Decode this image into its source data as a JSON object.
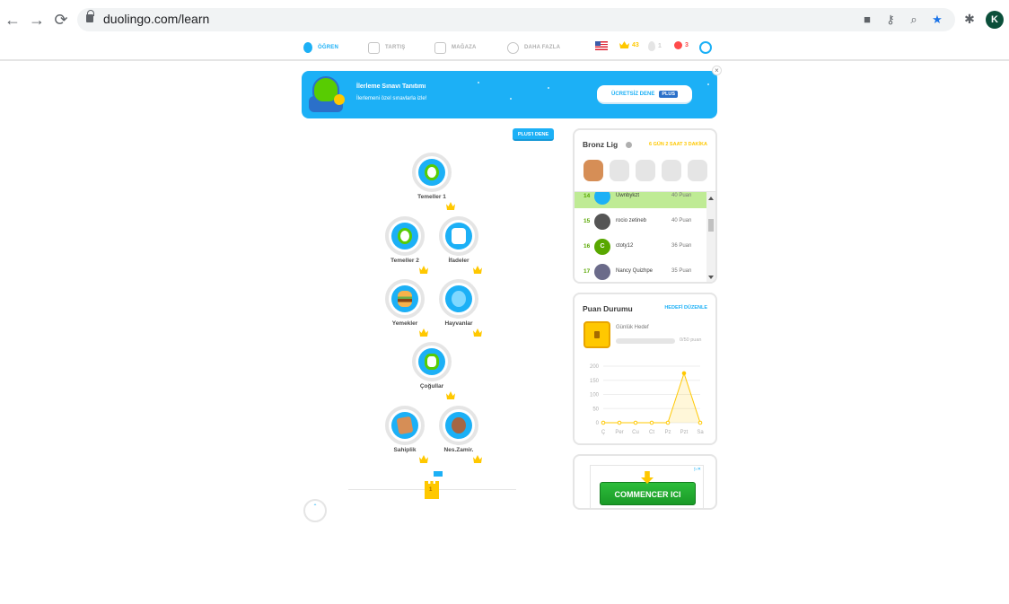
{
  "browser": {
    "url": "duolingo.com/learn",
    "profile_initial": "K"
  },
  "nav": {
    "items": [
      "ÖĞREN",
      "TARTIŞ",
      "MAĞAZA",
      "DAHA FAZLA"
    ],
    "crowns": "43",
    "streak": "1",
    "hearts": "3"
  },
  "banner": {
    "title": "İlerleme Sınavı Tanıtımı",
    "subtitle": "İlerlemeni özel sınavlarla izle!",
    "button_label": "ÜCRETSİZ DENE",
    "plus_tag": "PLUS"
  },
  "tree": {
    "try_plus": "PLUS'I DENE",
    "skills": [
      {
        "label": "Temeller 1",
        "color": "#58cc02"
      },
      {
        "label": "Temeller 2",
        "color": "#58cc02"
      },
      {
        "label": "İfadeler",
        "color": "#1cb0f6"
      },
      {
        "label": "Yemekler",
        "color": "#ff9600"
      },
      {
        "label": "Hayvanlar",
        "color": "#1cb0f6"
      },
      {
        "label": "Çoğullar",
        "color": "#58cc02"
      },
      {
        "label": "Sahiplik",
        "color": "#d68e56"
      },
      {
        "label": "Nes.Zamir.",
        "color": "#a56644"
      }
    ],
    "checkpoint": "1"
  },
  "league": {
    "title": "Bronz Lig",
    "time_left": "6 GÜN 2 SAAT 3 DAKİKA",
    "rows": [
      {
        "rank": "14",
        "name": "Uwnbykzt",
        "points": "40 Puan",
        "avatar": "",
        "color": "#1cb0f6"
      },
      {
        "rank": "15",
        "name": "rocio zetineb",
        "points": "40 Puan",
        "avatar": "",
        "color": "#555555"
      },
      {
        "rank": "16",
        "name": "ctoty12",
        "points": "36 Puan",
        "avatar": "C",
        "color": "#58a700"
      },
      {
        "rank": "17",
        "name": "Nancy Quizhpe",
        "points": "35 Puan",
        "avatar": "",
        "color": "#6b6b8a"
      }
    ]
  },
  "xp": {
    "title": "Puan Durumu",
    "edit_goal": "HEDEFİ DÜZENLE",
    "daily_goal": "Günlük Hedef",
    "goal_progress": "0/50 puan",
    "goal_fraction": 0
  },
  "chart_data": {
    "type": "line",
    "categories": [
      "Ç",
      "Per",
      "Cu",
      "Ct",
      "Pz",
      "Pzt",
      "Sa"
    ],
    "values": [
      0,
      0,
      0,
      0,
      0,
      175,
      0
    ],
    "yticks": [
      0,
      50,
      100,
      150,
      200
    ],
    "ylim": [
      0,
      200
    ],
    "color": "#ffc800"
  },
  "ad": {
    "button": "COMMENCER ICI"
  }
}
